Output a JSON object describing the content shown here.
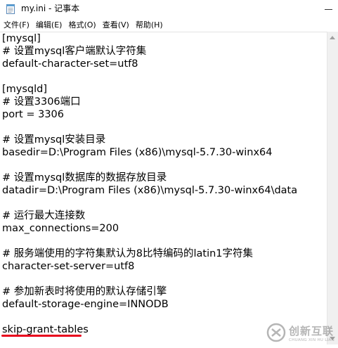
{
  "window": {
    "title": "my.ini - 记事本"
  },
  "menu": {
    "items": [
      "文件(F)",
      "编辑(E)",
      "格式(O)",
      "查看(V)",
      "帮助(H)"
    ]
  },
  "editor": {
    "lines": [
      "[mysql]",
      "# 设置mysql客户端默认字符集",
      "default-character-set=utf8",
      "",
      "[mysqld]",
      "# 设置3306端口",
      "port = 3306",
      "",
      "# 设置mysql安装目录",
      "basedir=D:\\Program Files (x86)\\mysql-5.7.30-winx64",
      "",
      "# 设置mysql数据库的数据存放目录",
      "datadir=D:\\Program Files (x86)\\mysql-5.7.30-winx64\\data",
      "",
      "# 运行最大连接数",
      "max_connections=200",
      "",
      "# 服务端使用的字符集默认为8比特编码的latin1字符集",
      "character-set-server=utf8",
      "",
      "# 参加新表时将使用的默认存储引擎",
      "default-storage-engine=INNODB",
      "",
      "skip-grant-tables"
    ]
  },
  "watermark": {
    "name": "创新互联",
    "tagline": "CHUANG XIN HU LIAN"
  },
  "colors": {
    "underline": "#e8001c"
  }
}
